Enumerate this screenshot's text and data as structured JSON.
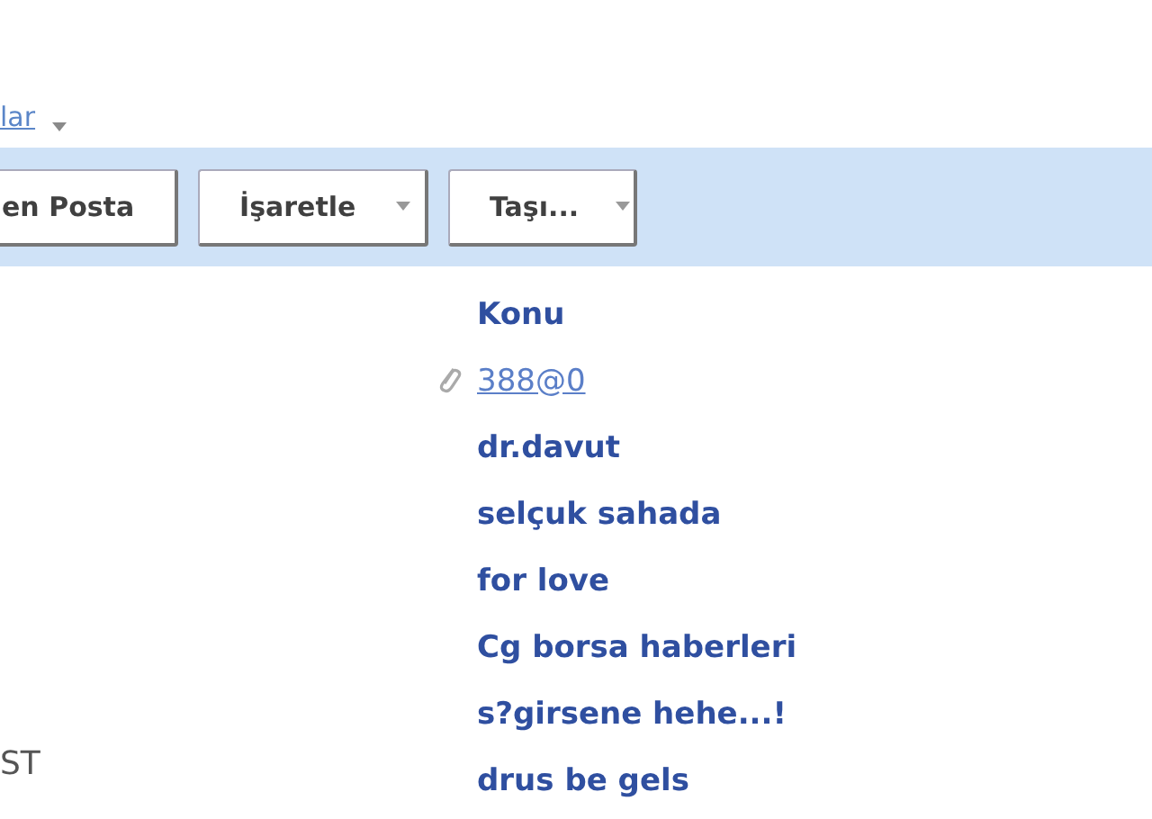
{
  "top_link": {
    "label": "lar",
    "dropdown": true
  },
  "toolbar": {
    "buttons": [
      {
        "label": "en Posta",
        "dropdown": false
      },
      {
        "label": "İşaretle",
        "dropdown": true
      },
      {
        "label": "Taşı...",
        "dropdown": true
      }
    ]
  },
  "message_list": {
    "column_header": "Konu",
    "rows": [
      {
        "subject": "388@0",
        "attachment": true,
        "hovered": true
      },
      {
        "subject": "dr.davut",
        "attachment": false,
        "hovered": false
      },
      {
        "subject": "selçuk sahada",
        "attachment": false,
        "hovered": false
      },
      {
        "subject": "for love",
        "attachment": false,
        "hovered": false
      },
      {
        "subject": "Cg borsa haberleri",
        "attachment": false,
        "hovered": false
      },
      {
        "subject": "s?girsene hehe...!",
        "attachment": false,
        "hovered": false
      },
      {
        "subject": "drus be gels",
        "attachment": false,
        "hovered": false
      }
    ]
  },
  "side_text": "ST"
}
